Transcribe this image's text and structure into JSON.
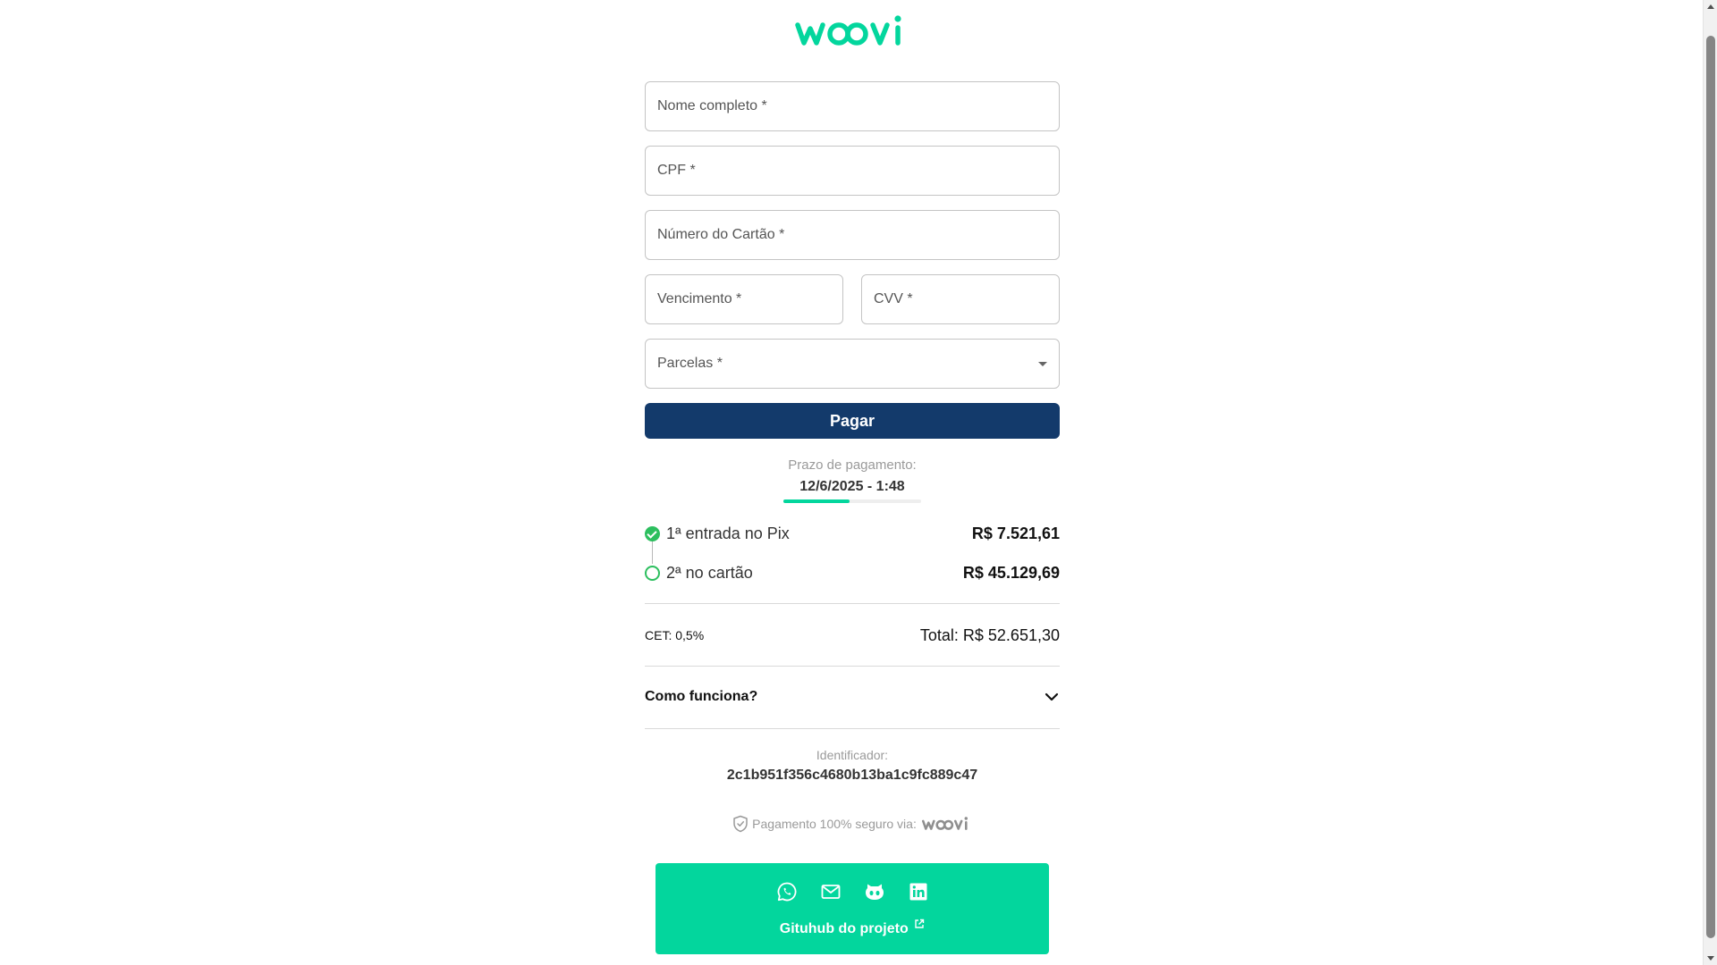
{
  "brand": {
    "name": "woovi",
    "color": "#03d69d",
    "primary": "#133a6b"
  },
  "form": {
    "name_placeholder": "Nome completo *",
    "cpf_placeholder": "CPF *",
    "card_placeholder": "Número do Cartão *",
    "expiry_placeholder": "Vencimento *",
    "cvv_placeholder": "CVV *",
    "installments_placeholder": "Parcelas *",
    "pay_label": "Pagar"
  },
  "deadline": {
    "label": "Prazo de pagamento:",
    "value": "12/6/2025 - 1:48",
    "progress": 0.48
  },
  "steps": [
    {
      "label": "1ª entrada no Pix",
      "amount": "R$ 7.521,61",
      "status": "done"
    },
    {
      "label": "2ª no cartão",
      "amount": "R$ 45.129,69",
      "status": "pending"
    }
  ],
  "summary": {
    "cet": "CET: 0,5%",
    "total": "Total: R$ 52.651,30"
  },
  "accordion": {
    "title": "Como funciona?"
  },
  "identifier": {
    "label": "Identificador:",
    "value": "2c1b951f356c4680b13ba1c9fc889c47"
  },
  "secure": {
    "text": "Pagamento 100% seguro via:",
    "brand": "woovi"
  },
  "footer": {
    "icons": [
      "whatsapp-icon",
      "mail-icon",
      "github-icon",
      "linkedin-icon"
    ],
    "github_label": "Gituhub do projeto"
  }
}
